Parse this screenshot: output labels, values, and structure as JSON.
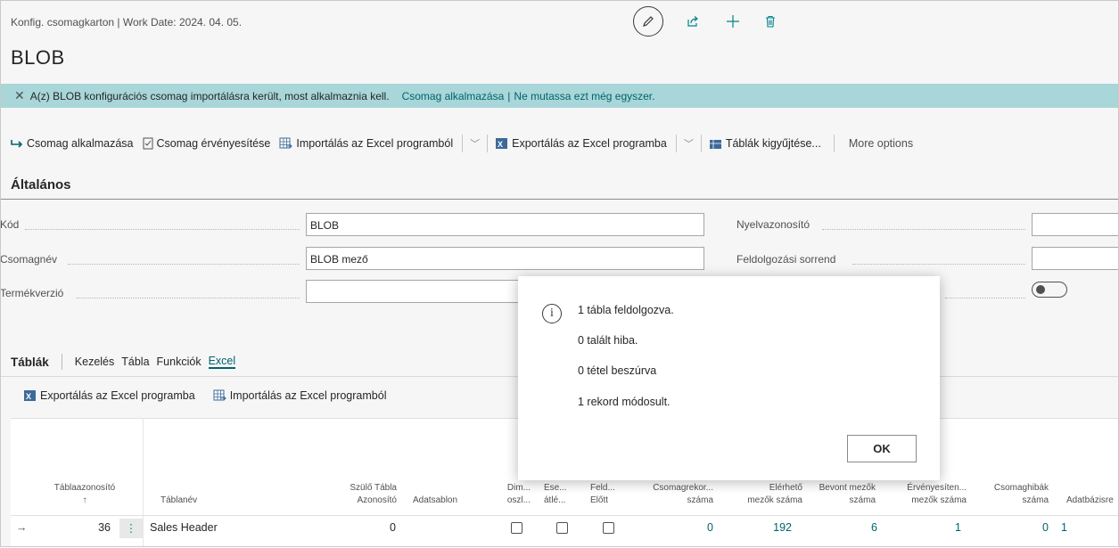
{
  "header": {
    "breadcrumb": "Konfig. csomagkarton | Work Date: 2024. 04. 05.",
    "title": "BLOB"
  },
  "banner": {
    "message": "A(z) BLOB konfigurációs csomag importálásra került, most alkalmaznia kell.",
    "apply_link": "Csomag alkalmazása",
    "separator": "|",
    "dismiss_link": "Ne mutassa ezt még egyszer."
  },
  "actions": {
    "apply": "Csomag alkalmazása",
    "validate": "Csomag érvényesítése",
    "import_excel": "Importálás az Excel programból",
    "export_excel": "Exportálás az Excel programba",
    "get_tables": "Táblák kigyűjtése...",
    "more": "More options"
  },
  "general": {
    "heading": "Általános",
    "code_label": "Kód",
    "code_value": "BLOB",
    "name_label": "Csomagnév",
    "name_value": "BLOB mező",
    "version_label": "Termékverzió",
    "version_value": "",
    "lang_label": "Nyelvazonosító",
    "order_label": "Feldolgozási sorrend"
  },
  "tables": {
    "heading": "Táblák",
    "tabs": [
      "Kezelés",
      "Tábla",
      "Funkciók",
      "Excel"
    ],
    "export_excel": "Exportálás az Excel programba",
    "import_excel": "Importálás az Excel programból",
    "columns": {
      "table_id": "Táblaazonosító",
      "sort": "↑",
      "table_name": "Táblanév",
      "parent_1": "Szülő Tábla",
      "parent_2": "Azonosító",
      "template": "Adatsablon",
      "dim_1": "Dim...",
      "dim_2": "oszl...",
      "skip_1": "Ese...",
      "skip_2": "átlé...",
      "proc_1": "Feld...",
      "proc_2": "Előtt",
      "pkgrec_1": "Csomagrekor...",
      "pkgrec_2": "száma",
      "avail_1": "Elérhető",
      "avail_2": "mezők száma",
      "incl_1": "Bevont mezők",
      "incl_2": "száma",
      "valid_1": "Érvényesíten...",
      "valid_2": "mezők száma",
      "err_1": "Csomaghibák",
      "err_2": "száma",
      "db": "Adatbázisre"
    },
    "row": {
      "arrow": "→",
      "table_id": "36",
      "menu": "⋮",
      "table_name": "Sales Header",
      "parent_id": "0",
      "pkg_records": "0",
      "avail_fields": "192",
      "incl_fields": "6",
      "valid_fields": "1",
      "errors": "0",
      "db": "1"
    }
  },
  "dialog": {
    "line1": "1 tábla feldolgozva.",
    "line2": "0 talált hiba.",
    "line3": "0 tétel beszúrva",
    "line4": "1 rekord módosult.",
    "ok": "OK",
    "info_glyph": "i"
  },
  "colors": {
    "accent": "#00636b",
    "banner": "#a8d6d9",
    "icon_teal": "#008489"
  }
}
